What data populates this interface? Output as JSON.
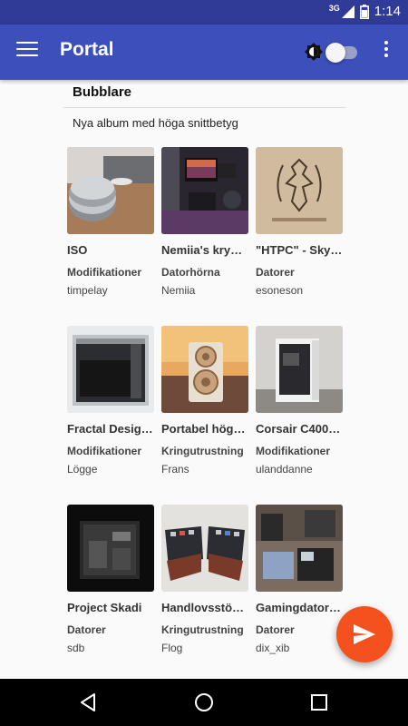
{
  "status_bar": {
    "network": "3G",
    "time": "1:14"
  },
  "app_bar": {
    "title": "Portal",
    "menu_icon": "menu-icon",
    "overflow_icon": "more-vert-icon",
    "brightness_icon": "brightness-icon",
    "dark_mode_toggle": "off"
  },
  "section": {
    "title": "Bubblare",
    "subtitle": "Nya album med höga snittbetyg"
  },
  "albums": [
    {
      "title": "ISO",
      "category": "Modifikationer",
      "user": "timpelay"
    },
    {
      "title": "Nemiia's kry…",
      "category": "Datorhörna",
      "user": "Nemiia"
    },
    {
      "title": "\"HTPC\" - Sky…",
      "category": "Datorer",
      "user": "esoneson"
    },
    {
      "title": "Fractal Desig…",
      "category": "Modifikationer",
      "user": "Lögge"
    },
    {
      "title": "Portabel hög…",
      "category": "Kringutrustning",
      "user": "Frans"
    },
    {
      "title": "Corsair C400…",
      "category": "Modifikationer",
      "user": "ulanddanne"
    },
    {
      "title": "Project Skadi",
      "category": "Datorer",
      "user": "sdb"
    },
    {
      "title": "Handlovsstö…",
      "category": "Kringutrustning",
      "user": "Flog"
    },
    {
      "title": "Gamingdator…",
      "category": "Datorer",
      "user": "dix_xib"
    }
  ],
  "fab": {
    "icon": "send-icon"
  },
  "nav": {
    "back": "back-icon",
    "home": "home-icon",
    "recents": "recents-icon"
  },
  "colors": {
    "status_bar": "#2f3b97",
    "app_bar": "#3d4fbb",
    "fab": "#f4511e",
    "background": "#fafafa"
  }
}
